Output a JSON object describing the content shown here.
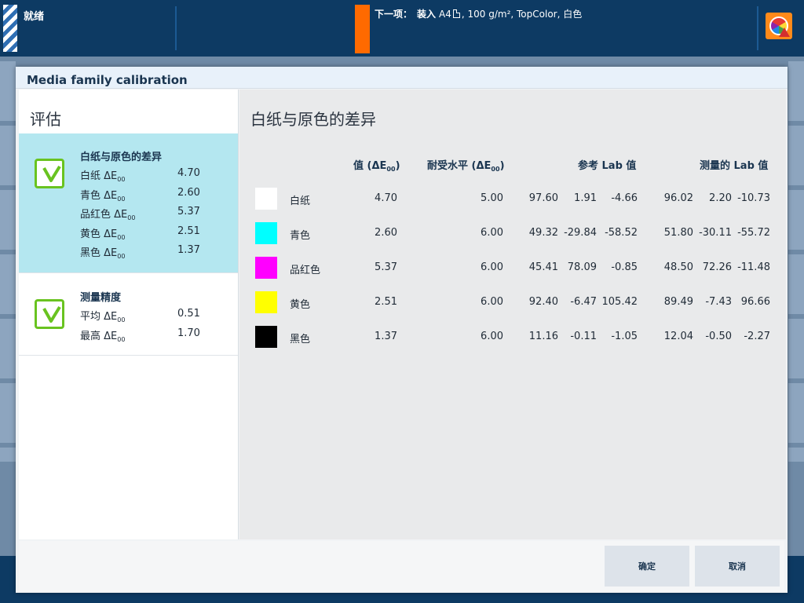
{
  "topbar": {
    "status": "就绪",
    "next_label": "下一项：",
    "next_action": "装入",
    "paper_size": "A4",
    "paper_details": ", 100 g/m², TopColor, 白色"
  },
  "dialog": {
    "title": "Media family calibration",
    "left_title": "评估",
    "right_title": "白纸与原色的差异",
    "card1": {
      "title": "白纸与原色的差异",
      "rows": [
        {
          "label": "白纸 ΔE",
          "sub": "00",
          "value": "4.70"
        },
        {
          "label": "青色 ΔE",
          "sub": "00",
          "value": "2.60"
        },
        {
          "label": "品红色 ΔE",
          "sub": "00",
          "value": "5.37"
        },
        {
          "label": "黄色 ΔE",
          "sub": "00",
          "value": "2.51"
        },
        {
          "label": "黑色 ΔE",
          "sub": "00",
          "value": "1.37"
        }
      ]
    },
    "card2": {
      "title": "测量精度",
      "rows": [
        {
          "label": "平均 ΔE",
          "sub": "00",
          "value": "0.51"
        },
        {
          "label": "最高 ΔE",
          "sub": "00",
          "value": "1.70"
        }
      ]
    },
    "table": {
      "headers": {
        "value": "值 (ΔE",
        "value_sub": "00",
        "value_end": ")",
        "tolerance": "耐受水平 (ΔE",
        "tolerance_sub": "00",
        "tolerance_end": ")",
        "reference": "参考 Lab 值",
        "measured": "测量的 Lab 值"
      },
      "rows": [
        {
          "name": "白纸",
          "swatch": "#ffffff",
          "value": "4.70",
          "tolerance": "5.00",
          "ref": [
            "97.60",
            "1.91",
            "-4.66"
          ],
          "meas": [
            "96.02",
            "2.20",
            "-10.73"
          ]
        },
        {
          "name": "青色",
          "swatch": "#00ffff",
          "value": "2.60",
          "tolerance": "6.00",
          "ref": [
            "49.32",
            "-29.84",
            "-58.52"
          ],
          "meas": [
            "51.80",
            "-30.11",
            "-55.72"
          ]
        },
        {
          "name": "品红色",
          "swatch": "#ff00ff",
          "value": "5.37",
          "tolerance": "6.00",
          "ref": [
            "45.41",
            "78.09",
            "-0.85"
          ],
          "meas": [
            "48.50",
            "72.26",
            "-11.48"
          ]
        },
        {
          "name": "黄色",
          "swatch": "#ffff00",
          "value": "2.51",
          "tolerance": "6.00",
          "ref": [
            "92.40",
            "-6.47",
            "105.42"
          ],
          "meas": [
            "89.49",
            "-7.43",
            "96.66"
          ]
        },
        {
          "name": "黑色",
          "swatch": "#000000",
          "value": "1.37",
          "tolerance": "6.00",
          "ref": [
            "11.16",
            "-0.11",
            "-1.05"
          ],
          "meas": [
            "12.04",
            "-0.50",
            "-2.27"
          ]
        }
      ]
    },
    "buttons": {
      "ok": "确定",
      "cancel": "取消"
    }
  },
  "colors": {
    "accent_orange": "#ff6a00",
    "check_green": "#69c320",
    "selected_card": "#b4e7f0",
    "header_navy": "#0d3a63"
  }
}
